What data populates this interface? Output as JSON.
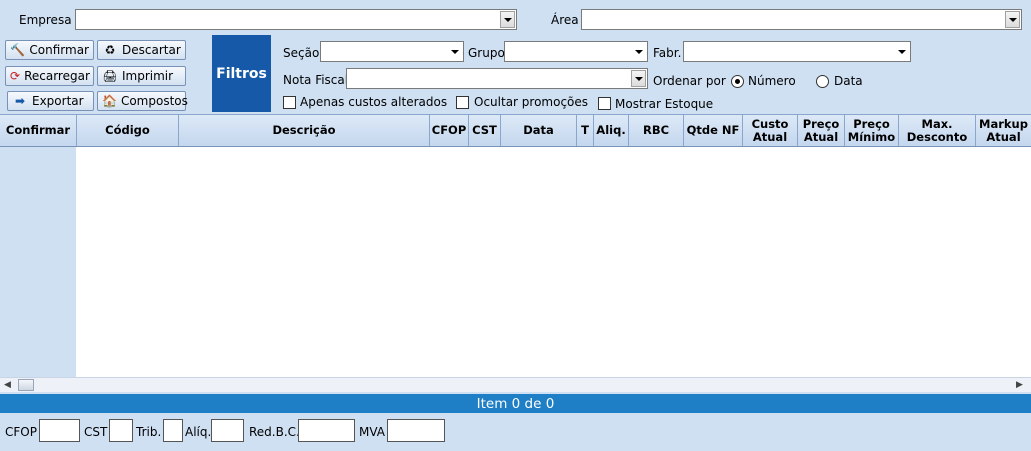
{
  "top": {
    "empresa_label": "Empresa",
    "empresa_value": "",
    "area_label": "Área",
    "area_value": ""
  },
  "buttons": {
    "confirmar": "Confirmar",
    "descartar": "Descartar",
    "recarregar": "Recarregar",
    "imprimir": "Imprimir",
    "exportar": "Exportar",
    "compostos": "Compostos"
  },
  "filters": {
    "title": "Filtros",
    "secao_label": "Seção",
    "grupo_label": "Grupo",
    "fabr_label": "Fabr.",
    "nota_fiscal_label": "Nota Fiscal",
    "ordenar_por_label": "Ordenar por",
    "radio_numero": "Número",
    "radio_data": "Data",
    "selected_order": "Número",
    "chk_custos": "Apenas custos alterados",
    "chk_promocoes": "Ocultar promoções",
    "chk_estoque": "Mostrar Estoque"
  },
  "grid": {
    "columns": [
      "Confirmar",
      "Código",
      "Descrição",
      "CFOP",
      "CST",
      "Data",
      "T",
      "Aliq.",
      "RBC",
      "Qtde NF",
      "Custo Atual",
      "Preço Atual",
      "Preço Mínimo",
      "Max. Desconto",
      "Markup Atual"
    ],
    "rows": []
  },
  "status": {
    "text": "Item 0 de 0"
  },
  "bottom": {
    "cfop_label": "CFOP",
    "cst_label": "CST",
    "trib_label": "Trib.",
    "aliq_label": "Alíq.",
    "redbc_label": "Red.B.C.",
    "mva_label": "MVA"
  },
  "colors": {
    "background": "#cfe0f3",
    "filtros_bg": "#1659a8",
    "status_bg": "#1e7ec6"
  }
}
